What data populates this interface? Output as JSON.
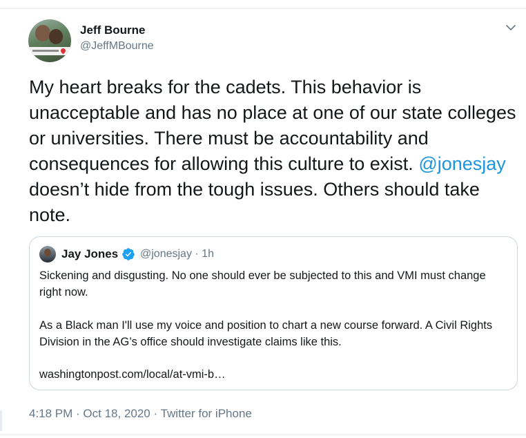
{
  "tweet": {
    "author": {
      "display_name": "Jeff Bourne",
      "handle": "@JeffMBourne"
    },
    "text_before_mention": "My heart breaks for the cadets. This behavior is unacceptable and has no place at one of our state colleges or universities.  There must be accountability and consequences for allowing this culture to exist.",
    "mention": "@jonesjay",
    "text_after_mention": " doesn’t hide from the tough issues.  Others should take note.",
    "time": "4:18 PM",
    "date": "Oct 18, 2020",
    "source": "Twitter for iPhone",
    "meta_separator": " · "
  },
  "quote": {
    "display_name": "Jay Jones",
    "handle": "@jonesjay",
    "age": "1h",
    "meta_separator": " · ",
    "paragraph_1": "Sickening and disgusting. No one should ever be subjected to this and VMI must change right now.",
    "paragraph_2": "As a Black man I'll use my voice and position to chart a new course forward. A Civil Rights Division in the AG’s office should investigate claims like this.",
    "link": "washingtonpost.com/local/at-vmi-b…"
  },
  "icons": {
    "caret": "chevron-down-icon",
    "verified": "verified-badge-icon"
  },
  "colors": {
    "link": "#1b95e0",
    "secondary_text": "#657786",
    "verified": "#1da1f2",
    "border": "#ccd6dd"
  }
}
